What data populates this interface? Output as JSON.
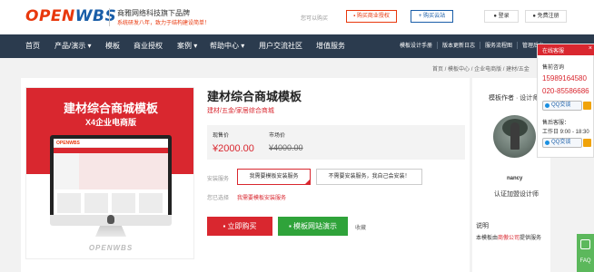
{
  "header": {
    "logo_part1": "OPEN",
    "logo_part2": "WBS",
    "slogan": "商雅网络科技旗下品牌",
    "slogan_sub": "系统研发八年，致力于结构建设简单！",
    "market_label": "您可以购买",
    "buy_auth_label": "购买商业授权",
    "cloud_label": "购买云站",
    "login_label": "登录",
    "register_label": "免费注册"
  },
  "nav": {
    "items": [
      "首页",
      "产品/演示 ▾",
      "模板",
      "商业授权",
      "案例 ▾",
      "帮助中心 ▾",
      "用户交流社区",
      "增值服务"
    ],
    "right_items": [
      "模板设计手册",
      "版本更新日志",
      "服务流程图",
      "管理后台"
    ]
  },
  "breadcrumb": [
    "首页",
    "模板中心",
    "企业电商版",
    "建材/五金"
  ],
  "banner": {
    "title": "建材综合商城模板",
    "subtitle": "X4企业电商版",
    "screen_logo": "OPENWBS",
    "footer_logo": "OPENWBS"
  },
  "product": {
    "title": "建材综合商城模板",
    "tags": "建材/五金/家居综合商城",
    "current_price_label": "现售价",
    "current_price": "¥2000.00",
    "market_price_label": "市场价",
    "market_price": "¥4000.00",
    "service_label": "安装服务",
    "option_install": "我需要模板安装服务",
    "option_no_install": "不需要安装服务，我自己会安装！",
    "config_label": "您已选择",
    "config_value": "我需要模板安装服务",
    "buy_button": "立即购买",
    "demo_button": "模板网站演示",
    "favorite_label": "收藏"
  },
  "author": {
    "heading": "模板作者 · 设计师",
    "name": "nancy",
    "badge": "认证加盟设计师",
    "note_heading": "说明",
    "note_prefix": "本模板由",
    "note_link": "商傲公司",
    "note_suffix": "提供服务"
  },
  "customer_service": {
    "header": "在线客服",
    "close_symbol": "×",
    "pre_sales_title": "售前咨询",
    "phone1": "15989164580",
    "phone2": "020-85586686",
    "qq_label": "QQ交谈",
    "after_sales_title": "售后客服：",
    "work_hours": "工作日 9:00 - 18:30"
  },
  "faq_label": "FAQ",
  "colors": {
    "brand_red": "#d9272f",
    "nav_bg": "#2b3b4e",
    "green": "#2fa33a"
  }
}
